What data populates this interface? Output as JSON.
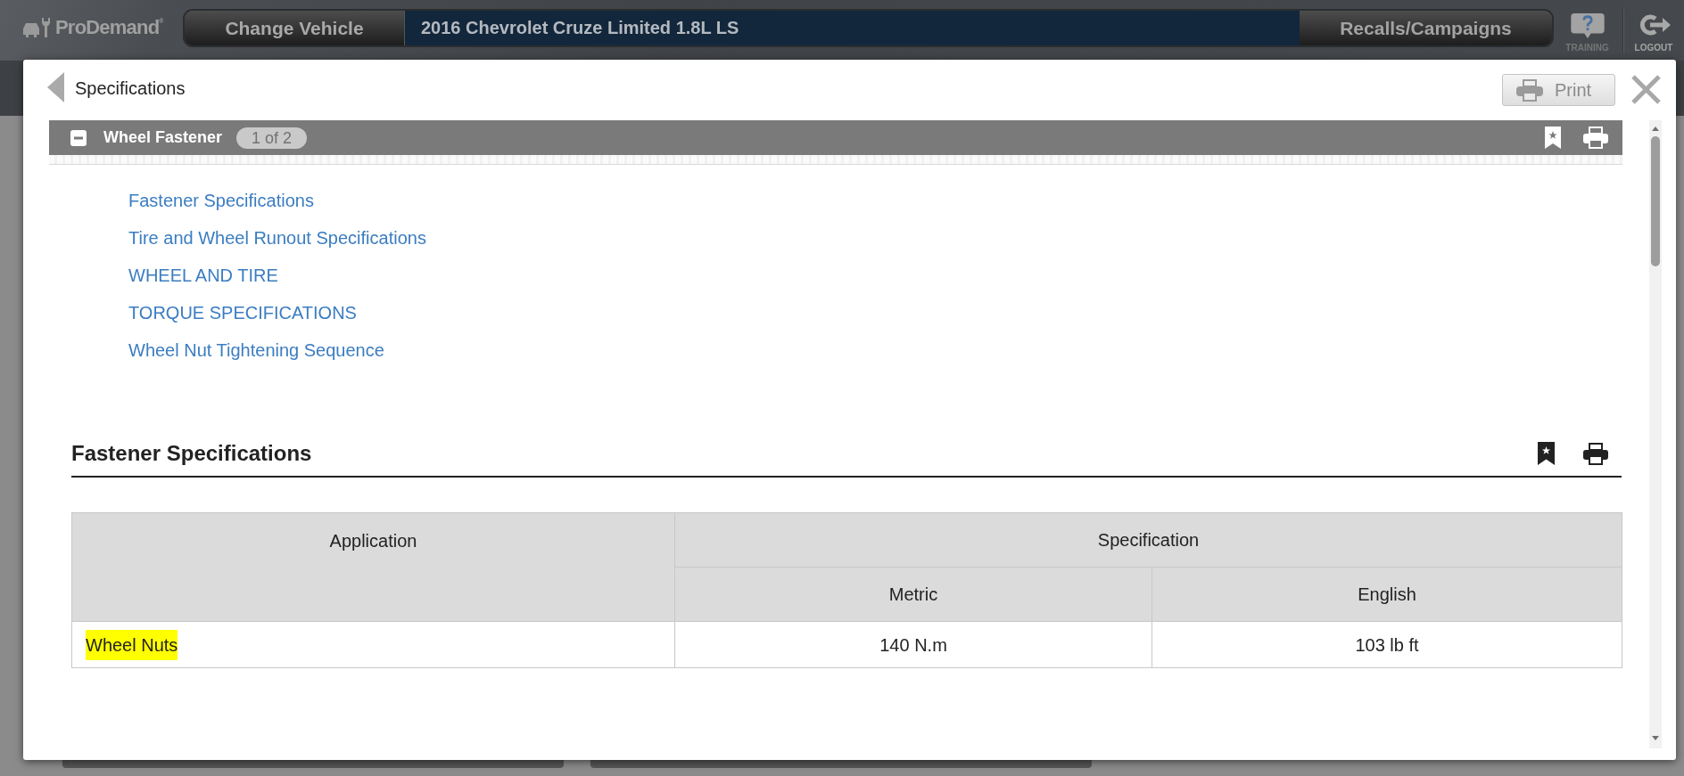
{
  "top_bar": {
    "logo": "ProDemand$^{®}$",
    "change_vehicle": "Change Vehicle",
    "vehicle": "2016 Chevrolet Cruze Limited 1.8L LS",
    "recalls": "Recalls/Campaigns",
    "training": "TRAINING",
    "logout": "LOGOUT"
  },
  "dialog": {
    "title": "Specifications",
    "print": "Print"
  },
  "section": {
    "title": "Wheel Fastener",
    "count": "1 of 2",
    "expanded": true
  },
  "links": [
    "Fastener Specifications",
    "Tire and Wheel Runout Specifications",
    "WHEEL AND TIRE",
    "TORQUE SPECIFICATIONS",
    "Wheel Nut Tightening Sequence"
  ],
  "spec": {
    "title": "Fastener Specifications",
    "table": {
      "columns": [
        {
          "label": "Application"
        },
        {
          "label": "Specification",
          "colspan": 2,
          "children": [
            {
              "label": "Metric"
            },
            {
              "label": "English"
            }
          ]
        }
      ],
      "rows": [
        {
          "cells": [
            {
              "text": "Wheel Nuts",
              "highlighted": true
            },
            {
              "text": "140 N.m",
              "highlighted": false
            },
            {
              "text": "103 lb ft",
              "highlighted": false
            }
          ]
        }
      ]
    }
  }
}
